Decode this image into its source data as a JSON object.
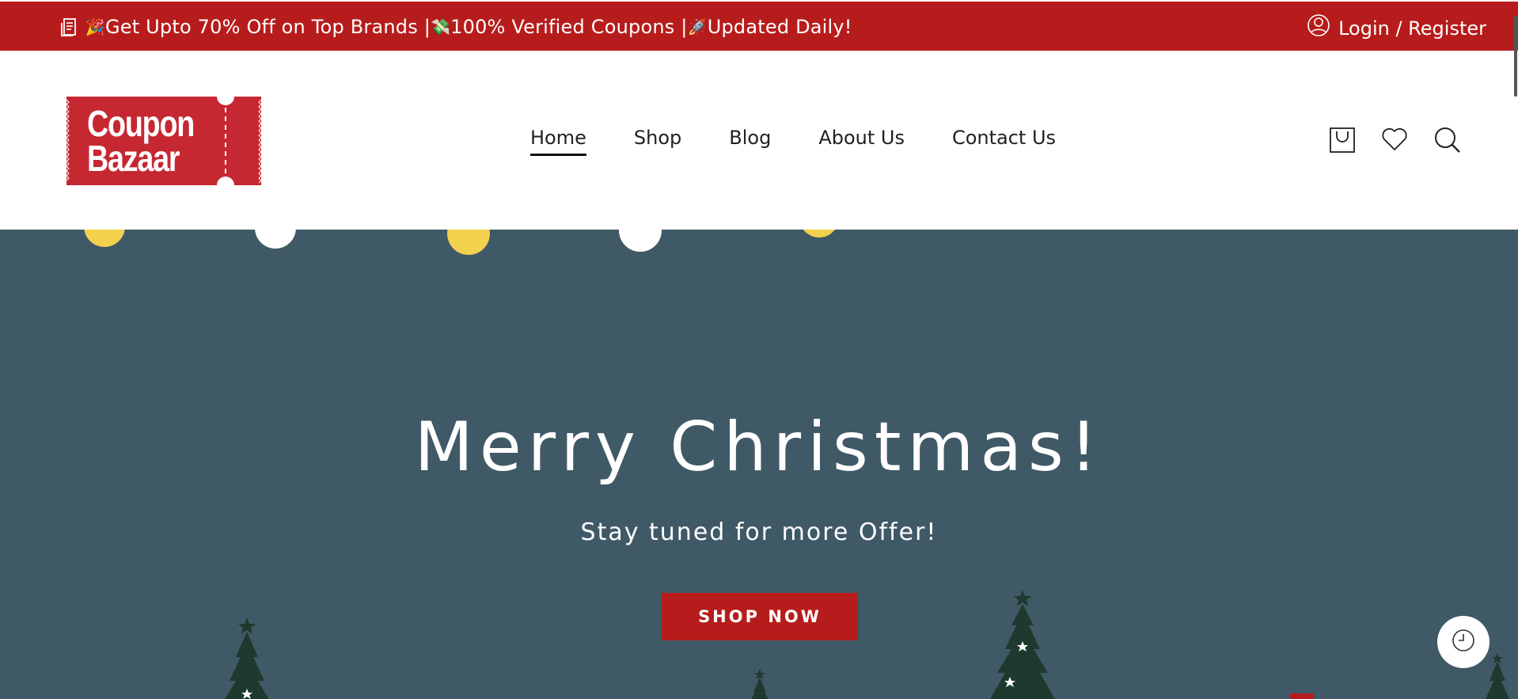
{
  "topbar": {
    "promo_icon": "coupon-icon",
    "promo_parts": [
      {
        "emoji": "🎉",
        "text": "Get Upto 70% Off on Top Brands |"
      },
      {
        "emoji": "💸",
        "text": "100% Verified Coupons |"
      },
      {
        "emoji": "🚀",
        "text": "Updated Daily!"
      }
    ],
    "login_label": "Login / Register",
    "bg_color": "#b71c1c"
  },
  "logo": {
    "line1": "Coupon",
    "line2": "Bazaar",
    "color": "#c62832"
  },
  "nav": {
    "items": [
      {
        "label": "Home",
        "active": true
      },
      {
        "label": "Shop",
        "active": false
      },
      {
        "label": "Blog",
        "active": false
      },
      {
        "label": "About Us",
        "active": false
      },
      {
        "label": "Contact Us",
        "active": false
      }
    ]
  },
  "header_icons": [
    "cart-icon",
    "heart-icon",
    "search-icon"
  ],
  "hero": {
    "title": "Merry Christmas!",
    "subtitle": "Stay tuned for more Offer!",
    "button_label": "SHOP NOW",
    "bg_color": "#405966",
    "accent_color": "#b71c1c"
  },
  "fab_icon": "clock-icon"
}
